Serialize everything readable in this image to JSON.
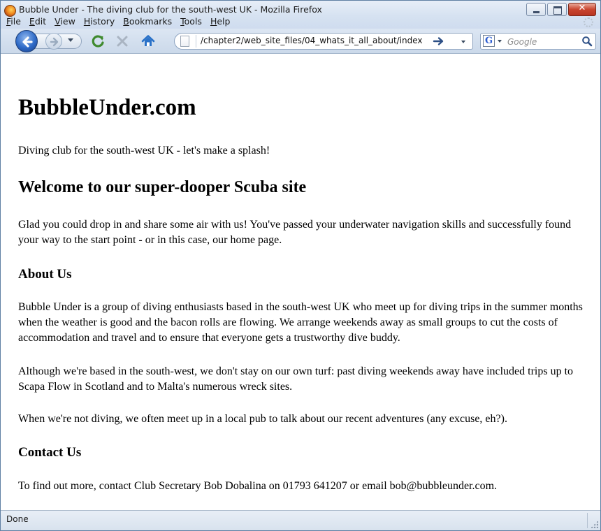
{
  "window": {
    "title": "Bubble Under - The diving club for the south-west UK - Mozilla Firefox"
  },
  "menu": {
    "items": [
      "File",
      "Edit",
      "View",
      "History",
      "Bookmarks",
      "Tools",
      "Help"
    ]
  },
  "toolbar": {
    "url": "/chapter2/web_site_files/04_whats_it_all_about/index",
    "search_placeholder": "Google",
    "search_engine_letter": "G"
  },
  "page": {
    "site_title": "BubbleUnder.com",
    "tagline": "Diving club for the south-west UK - let's make a splash!",
    "welcome_heading": "Welcome to our super-dooper Scuba site",
    "welcome_paragraph": "Glad you could drop in and share some air with us! You've passed your underwater navigation skills and successfully found your way to the start point - or in this case, our home page.",
    "about_heading": "About Us",
    "about_paragraph_1": "Bubble Under is a group of diving enthusiasts based in the south-west UK who meet up for diving trips in the summer months when the weather is good and the bacon rolls are flowing. We arrange weekends away as small groups to cut the costs of accommodation and travel and to ensure that everyone gets a trustworthy dive buddy.",
    "about_paragraph_2": "Although we're based in the south-west, we don't stay on our own turf: past diving weekends away have included trips up to Scapa Flow in Scotland and to Malta's numerous wreck sites.",
    "about_paragraph_3": "When we're not diving, we often meet up in a local pub to talk about our recent adventures (any excuse, eh?).",
    "contact_heading": "Contact Us",
    "contact_paragraph": "To find out more, contact Club Secretary Bob Dobalina on 01793 641207 or email bob@bubbleunder.com."
  },
  "status": {
    "text": "Done"
  },
  "icons": {
    "app": "firefox-icon",
    "back": "back-arrow-icon",
    "forward": "forward-arrow-icon",
    "reload": "reload-icon",
    "stop": "stop-icon",
    "home": "home-icon",
    "go": "go-arrow-icon",
    "search": "magnifier-icon"
  },
  "colors": {
    "reload_accent": "#3f8a2e",
    "stop_accent": "#a9b4c2",
    "home_accent": "#2b72c8"
  }
}
